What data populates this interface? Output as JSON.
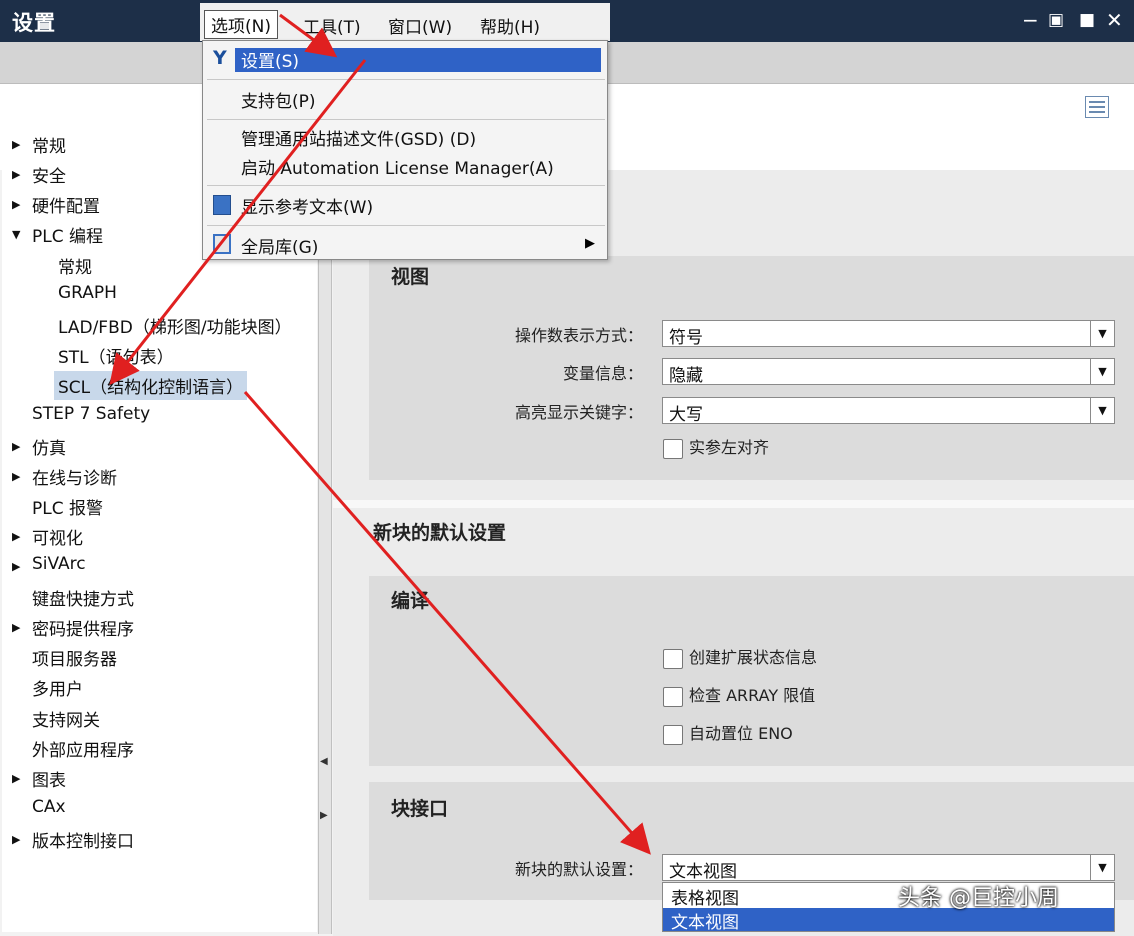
{
  "window": {
    "title": "设置",
    "controls": [
      "−",
      "▣",
      "■",
      "✕"
    ]
  },
  "menubar": {
    "items": [
      {
        "label": "选项(N)"
      },
      {
        "label": "工具(T)"
      },
      {
        "label": "窗口(W)"
      },
      {
        "label": "帮助(H)"
      }
    ]
  },
  "options_menu": {
    "items": [
      {
        "label": "设置(S)",
        "icon": "wrench-icon"
      },
      {
        "label": "支持包(P)"
      },
      {
        "label": "管理通用站描述文件(GSD) (D)"
      },
      {
        "label": "启动 Automation License Manager(A)"
      },
      {
        "label": "显示参考文本(W)",
        "icon": "reference-text-icon"
      },
      {
        "label": "全局库(G)",
        "icon": "global-library-icon"
      }
    ]
  },
  "tree": {
    "items": [
      {
        "label": "常规",
        "expander": "▶"
      },
      {
        "label": "安全",
        "expander": "▶"
      },
      {
        "label": "硬件配置",
        "expander": "▶"
      },
      {
        "label": "PLC 编程",
        "expander": "▼"
      },
      {
        "label": "常规"
      },
      {
        "label": "GRAPH"
      },
      {
        "label": "LAD/FBD（梯形图/功能块图）"
      },
      {
        "label": "STL（语句表）"
      },
      {
        "label": "SCL（结构化控制语言）"
      },
      {
        "label": "STEP 7 Safety"
      },
      {
        "label": "仿真",
        "expander": "▶"
      },
      {
        "label": "在线与诊断",
        "expander": "▶"
      },
      {
        "label": "PLC 报警"
      },
      {
        "label": "可视化",
        "expander": "▶"
      },
      {
        "label": "SiVArc",
        "expander": "▶"
      },
      {
        "label": "键盘快捷方式"
      },
      {
        "label": "密码提供程序",
        "expander": "▶"
      },
      {
        "label": "项目服务器"
      },
      {
        "label": "多用户"
      },
      {
        "label": "支持网关"
      },
      {
        "label": "外部应用程序"
      },
      {
        "label": "图表",
        "expander": "▶"
      },
      {
        "label": "CAx"
      },
      {
        "label": "版本控制接口",
        "expander": "▶"
      }
    ]
  },
  "view_section": {
    "heading": "视图",
    "fields": [
      {
        "label": "操作数表示方式：",
        "value": "符号"
      },
      {
        "label": "变量信息：",
        "value": "隐藏"
      },
      {
        "label": "高亮显示关键字：",
        "value": "大写"
      }
    ],
    "checkbox": "实参左对齐"
  },
  "new_block_section": {
    "heading": "新块的默认设置",
    "compile": {
      "heading": "编译",
      "checkboxes": [
        "创建扩展状态信息",
        "检查 ARRAY 限值",
        "自动置位 ENO"
      ]
    },
    "interface": {
      "heading": "块接口",
      "label": "新块的默认设置：",
      "value": "文本视图",
      "options": [
        "表格视图",
        "文本视图"
      ]
    }
  },
  "watermark": "头条 @巨控小周",
  "colors": {
    "titlebar": "#1d2f48",
    "highlight": "#2f62c6",
    "arrow": "#e02020"
  }
}
